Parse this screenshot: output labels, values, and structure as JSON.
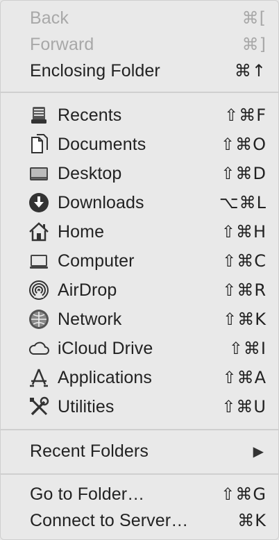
{
  "menu": {
    "nav": [
      {
        "label": "Back",
        "shortcut": "⌘[",
        "enabled": false
      },
      {
        "label": "Forward",
        "shortcut": "⌘]",
        "enabled": false
      },
      {
        "label": "Enclosing Folder",
        "shortcut": "⌘↑",
        "enabled": true
      }
    ],
    "places": [
      {
        "label": "Recents",
        "shortcut": "⇧⌘F",
        "icon": "recents-icon"
      },
      {
        "label": "Documents",
        "shortcut": "⇧⌘O",
        "icon": "documents-icon"
      },
      {
        "label": "Desktop",
        "shortcut": "⇧⌘D",
        "icon": "desktop-icon"
      },
      {
        "label": "Downloads",
        "shortcut": "⌥⌘L",
        "icon": "downloads-icon"
      },
      {
        "label": "Home",
        "shortcut": "⇧⌘H",
        "icon": "home-icon"
      },
      {
        "label": "Computer",
        "shortcut": "⇧⌘C",
        "icon": "computer-icon"
      },
      {
        "label": "AirDrop",
        "shortcut": "⇧⌘R",
        "icon": "airdrop-icon"
      },
      {
        "label": "Network",
        "shortcut": "⇧⌘K",
        "icon": "network-icon"
      },
      {
        "label": "iCloud Drive",
        "shortcut": "⇧⌘I",
        "icon": "icloud-icon"
      },
      {
        "label": "Applications",
        "shortcut": "⇧⌘A",
        "icon": "applications-icon"
      },
      {
        "label": "Utilities",
        "shortcut": "⇧⌘U",
        "icon": "utilities-icon"
      }
    ],
    "recent_folders": {
      "label": "Recent Folders",
      "submenu_arrow": "▶"
    },
    "go": [
      {
        "label": "Go to Folder…",
        "shortcut": "⇧⌘G"
      },
      {
        "label": "Connect to Server…",
        "shortcut": "⌘K"
      }
    ]
  }
}
